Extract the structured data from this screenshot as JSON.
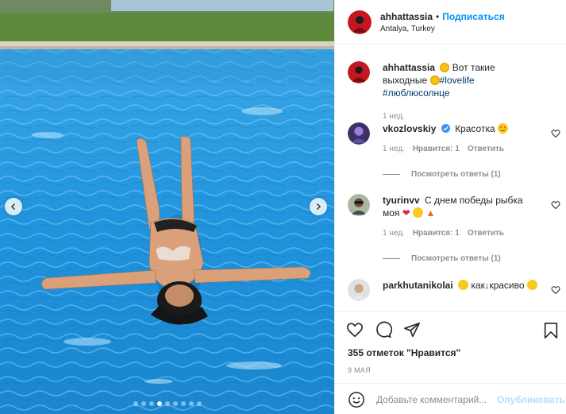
{
  "post": {
    "username": "ahhattassia",
    "separator": "•",
    "follow_label": "Подписаться",
    "location": "Antalya, Turkey",
    "avatar_icon": "user-avatar-red",
    "carousel": {
      "slide_count": 9,
      "active_index": 3
    }
  },
  "caption": {
    "username": "ahhattassia",
    "text_before": "Вот такие выходные",
    "tags": [
      "#lovelife",
      "#люблюсолнце"
    ],
    "time": "1 нед."
  },
  "comments": [
    {
      "username": "vkozlovskiy",
      "verified": true,
      "text": "Красотка",
      "emoji": "heart-eyes",
      "time": "1 нед.",
      "likes": "Нравится: 1",
      "reply": "Ответить",
      "view_replies": "Посмотреть ответы (1)"
    },
    {
      "username": "tyurinvv",
      "text": "С днем победы рыбка моя",
      "emoji": "heart hug fire",
      "time": "1 нед.",
      "likes": "Нравится: 1",
      "reply": "Ответить",
      "view_replies": "Посмотреть ответы (1)"
    },
    {
      "username": "parkhutanikolai",
      "text_a": "как",
      "text_b": "красиво",
      "emoji": "grin arrow hug"
    }
  ],
  "footer": {
    "likes_label": "355 отметок \"Нравится\"",
    "date": "9 МАЯ",
    "comment_placeholder": "Добавьте комментарий...",
    "publish_label": "Опубликовать"
  },
  "colors": {
    "accent": "#0095f6",
    "publish_disabled": "#b2dffc",
    "pool": "#1e8fd8",
    "text": "#262626",
    "muted": "#8e8e8e"
  }
}
